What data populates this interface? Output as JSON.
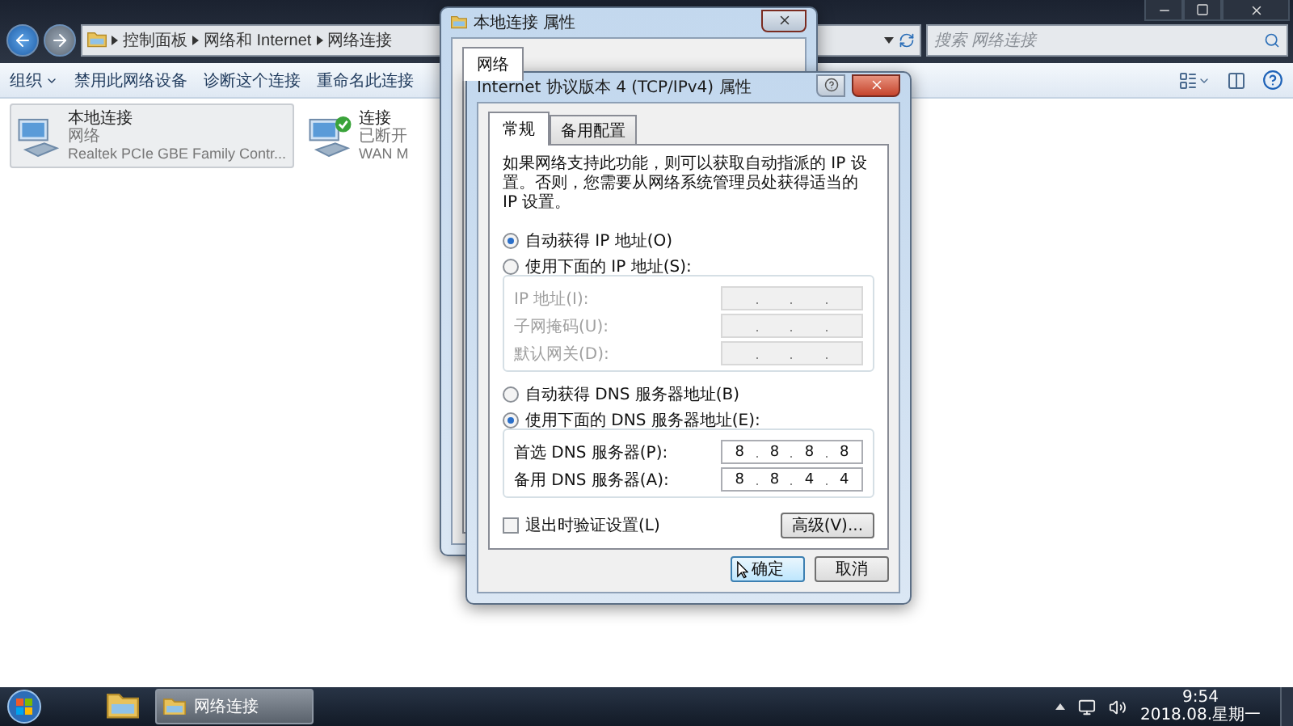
{
  "explorer": {
    "breadcrumb": [
      "控制面板",
      "网络和 Internet",
      "网络连接"
    ],
    "search": {
      "placeholder": "搜索 网络连接"
    },
    "toolbar": [
      {
        "label": "组织",
        "kind": "menu"
      },
      {
        "label": "禁用此网络设备",
        "kind": "button"
      },
      {
        "label": "诊断这个连接",
        "kind": "button"
      },
      {
        "label": "重命名此连接",
        "kind": "button"
      }
    ],
    "connections": [
      {
        "name": "本地连接",
        "status": "网络",
        "device": "Realtek PCIe GBE Family Contr...",
        "kind": "lan",
        "selected": true
      },
      {
        "name": "连接",
        "status": "已断开",
        "device": "WAN M",
        "kind": "wan",
        "selected": false
      }
    ]
  },
  "back_dialog": {
    "title": "本地连接 属性",
    "tabs": [
      {
        "label": "网络",
        "selected": true
      }
    ]
  },
  "ipv4_dialog": {
    "title": "Internet 协议版本 4 (TCP/IPv4) 属性",
    "tabs": [
      {
        "label": "常规",
        "selected": true
      },
      {
        "label": "备用配置",
        "selected": false
      }
    ],
    "intro": "如果网络支持此功能，则可以获取自动指派的 IP 设置。否则，您需要从网络系统管理员处获得适当的 IP 设置。",
    "sections": [
      {
        "radios": [
          {
            "label": "自动获得 IP 地址(O)",
            "selected": true
          },
          {
            "label": "使用下面的 IP 地址(S):",
            "selected": false
          }
        ],
        "fields": [
          {
            "label": "IP 地址(I):",
            "disabled": true
          },
          {
            "label": "子网掩码(U):",
            "disabled": true
          },
          {
            "label": "默认网关(D):",
            "disabled": true
          }
        ]
      },
      {
        "radios": [
          {
            "label": "自动获得 DNS 服务器地址(B)",
            "selected": false
          },
          {
            "label": "使用下面的 DNS 服务器地址(E):",
            "selected": true
          }
        ],
        "fields": [
          {
            "label": "首选 DNS 服务器(P):",
            "disabled": false,
            "octets": [
              "8",
              "8",
              "8",
              "8"
            ]
          },
          {
            "label": "备用 DNS 服务器(A):",
            "disabled": false,
            "octets": [
              "8",
              "8",
              "4",
              "4"
            ]
          }
        ]
      }
    ],
    "validate": {
      "label": "退出时验证设置(L)",
      "checked": false
    },
    "advanced": "高级(V)...",
    "buttons": [
      {
        "label": "确定",
        "kind": "default"
      },
      {
        "label": "取消",
        "kind": "normal"
      }
    ]
  },
  "taskbar": {
    "tasks": [
      {
        "label": "网络连接",
        "selected": true
      }
    ],
    "clock": {
      "time": "9:54",
      "date": "2018.08.星期一"
    }
  }
}
